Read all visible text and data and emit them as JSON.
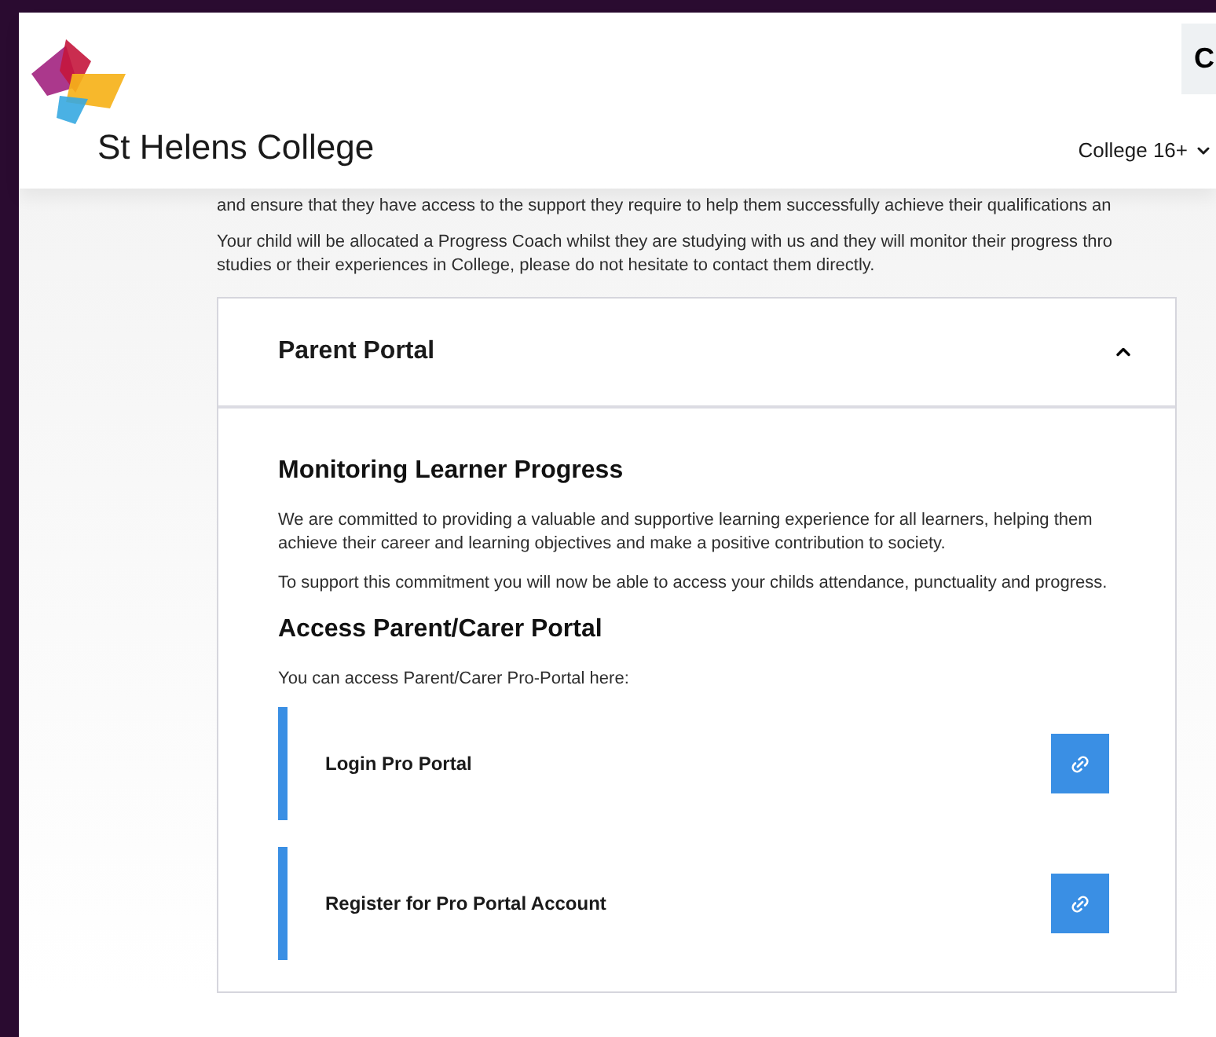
{
  "header": {
    "logo_text": "St Helens College",
    "corner_button": "C",
    "nav_item": "College 16+"
  },
  "intro": [
    "and ensure that they have access to the support they require to help them successfully achieve their qualifications an",
    "Your child will be allocated a Progress Coach whilst they are studying with us and they will monitor their progress thro",
    "studies or their experiences in College, please do not hesitate to contact them directly."
  ],
  "accordion": {
    "title": "Parent Portal",
    "expanded": true,
    "sections": [
      {
        "heading": "Monitoring Learner Progress",
        "paragraphs": [
          "We are committed to providing a valuable and supportive learning experience for all learners, helping them achieve their career and learning objectives and make a positive contribution to society.",
          "To support this commitment you will now be able to access your childs attendance, punctuality and progress."
        ]
      },
      {
        "heading": "Access Parent/Carer Portal",
        "paragraphs": [
          "You can access Parent/Carer Pro-Portal here:"
        ]
      }
    ],
    "links": [
      {
        "label": "Login Pro Portal"
      },
      {
        "label": "Register for Pro Portal Account"
      }
    ]
  }
}
